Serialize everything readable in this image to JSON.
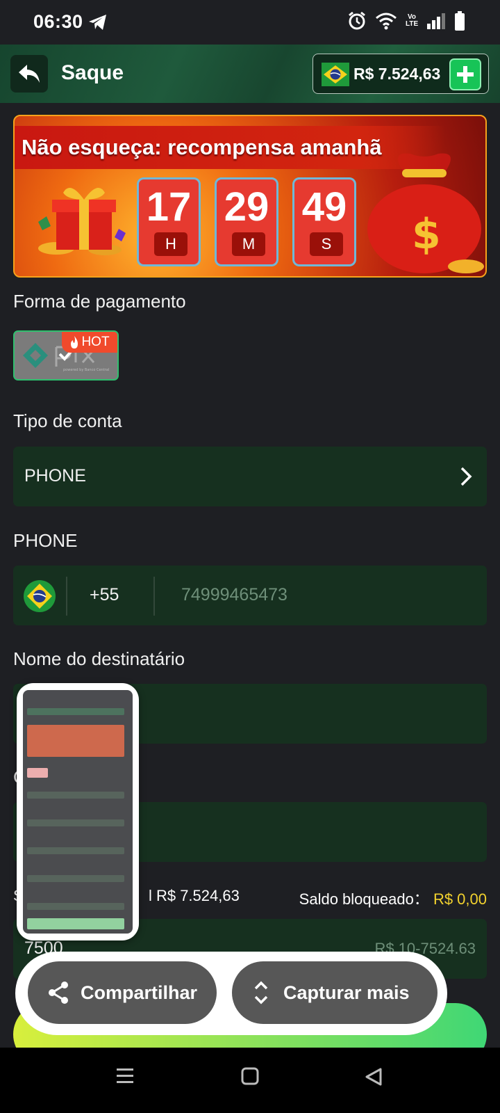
{
  "status_bar": {
    "time": "06:30",
    "volte_top": "Vo",
    "volte_bottom": "LTE"
  },
  "header": {
    "title": "Saque",
    "balance": "R$ 7.524,63"
  },
  "banner": {
    "title": "Não esqueça: recompensa amanhã",
    "countdown": [
      {
        "value": "17",
        "unit": "H"
      },
      {
        "value": "29",
        "unit": "M"
      },
      {
        "value": "49",
        "unit": "S"
      }
    ]
  },
  "payment": {
    "label": "Forma de pagamento",
    "method": "pix",
    "method_sub": "powered by Banco Central",
    "badge": "HOT"
  },
  "account_type": {
    "label": "Tipo de conta",
    "value": "PHONE"
  },
  "phone": {
    "label": "PHONE",
    "dial_code": "+55",
    "number": "74999465473"
  },
  "recipient": {
    "label": "Nome do destinatário",
    "value": ""
  },
  "cpf": {
    "label": "C",
    "value": ""
  },
  "saldo": {
    "available_prefix": "S",
    "available_label_tail": "l",
    "available_value": "R$ 7.524,63",
    "blocked_label": "Saldo bloqueado：",
    "blocked_value": "R$ 0,00"
  },
  "amount": {
    "value": "7500",
    "range": "R$ 10-7524.63"
  },
  "capture_toolbar": {
    "share_label": "Compartilhar",
    "capture_more_label": "Capturar mais"
  },
  "colors": {
    "accent_green": "#17c457",
    "field_bg": "#16301f",
    "yellow": "#f2d22e",
    "hot": "#f04a2c"
  }
}
